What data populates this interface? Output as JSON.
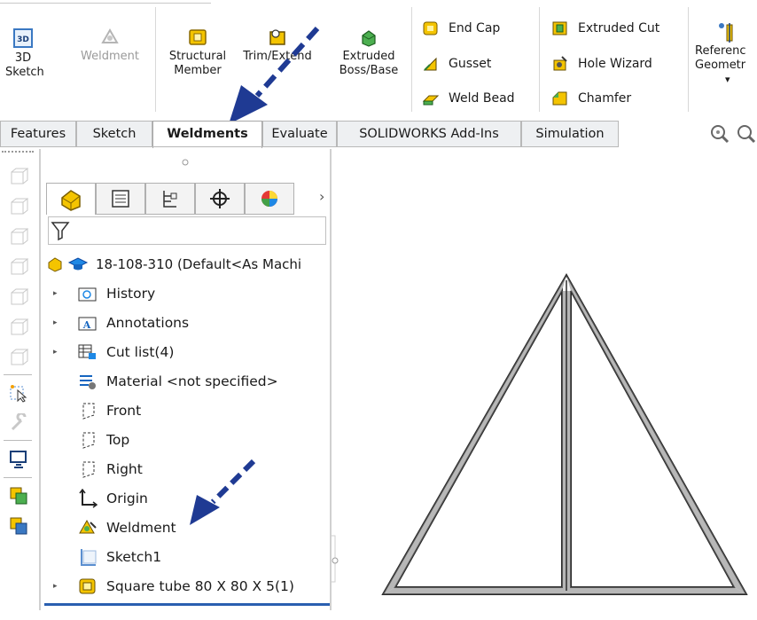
{
  "ribbon": {
    "sketch3d": {
      "label1": "3D",
      "label2": "Sketch",
      "icon_text": "3D"
    },
    "weldment": {
      "label": "Weldment"
    },
    "structural_member": {
      "label1": "Structural",
      "label2": "Member"
    },
    "trim_extend": {
      "label": "Trim/Extend"
    },
    "extruded_boss": {
      "label1": "Extruded",
      "label2": "Boss/Base"
    },
    "col1": [
      "End Cap",
      "Gusset",
      "Weld Bead"
    ],
    "col2": [
      "Extruded Cut",
      "Hole Wizard",
      "Chamfer"
    ],
    "reference_geometry": {
      "label1": "Referenc",
      "label2": "Geometr",
      "dropdown": "▾"
    }
  },
  "tabs": [
    "Features",
    "Sketch",
    "Weldments",
    "Evaluate",
    "SOLIDWORKS Add-Ins",
    "Simulation"
  ],
  "tree": {
    "root": "18-108-310  (Default<As Machi",
    "items": [
      "History",
      "Annotations",
      "Cut list(4)",
      "Material <not specified>",
      "Front",
      "Top",
      "Right",
      "Origin",
      "Weldment",
      "Sketch1",
      "Square tube 80 X 80 X 5(1)"
    ],
    "expand_glyph": "▸"
  },
  "colors": {
    "accent_arrow": "#1f3a93",
    "tab_bg": "#eef0f2",
    "selection": "#2a5fb0"
  }
}
